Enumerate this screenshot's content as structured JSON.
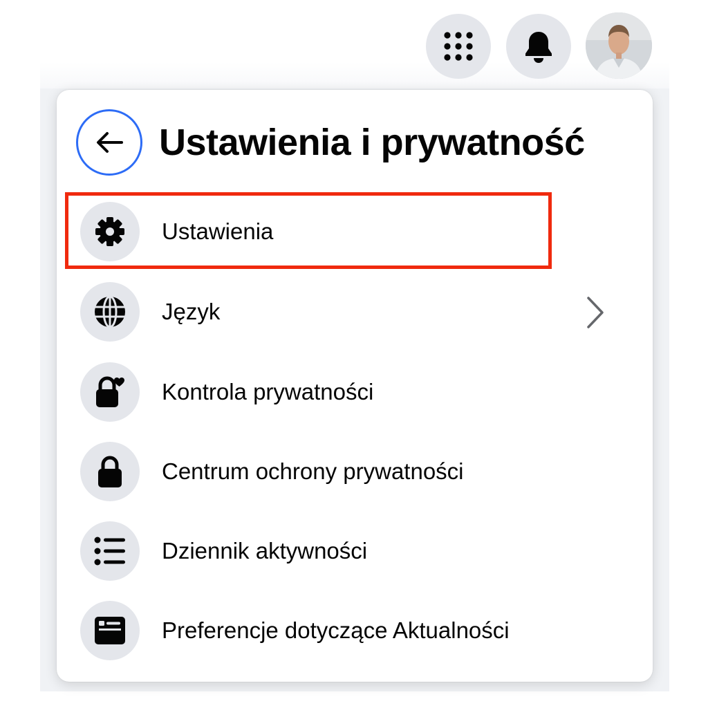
{
  "topbar": {
    "menu_icon": "grid-menu-icon",
    "notifications_icon": "bell-icon",
    "avatar": "profile-avatar"
  },
  "panel": {
    "title": "Ustawienia i prywatność",
    "back_icon": "arrow-left-icon",
    "items": [
      {
        "label": "Ustawienia",
        "icon": "gear-icon",
        "highlighted": true
      },
      {
        "label": "Język",
        "icon": "globe-icon",
        "has_chevron": true
      },
      {
        "label": "Kontrola prywatności",
        "icon": "lock-heart-icon"
      },
      {
        "label": "Centrum ochrony prywatności",
        "icon": "lock-icon"
      },
      {
        "label": "Dziennik aktywności",
        "icon": "list-icon"
      },
      {
        "label": "Preferencje dotyczące Aktualności",
        "icon": "feed-icon"
      }
    ]
  },
  "colors": {
    "focus_ring": "#2d6cf6",
    "highlight_border": "#f02a0e",
    "icon_bg": "#e4e6eb",
    "text": "#050505"
  }
}
